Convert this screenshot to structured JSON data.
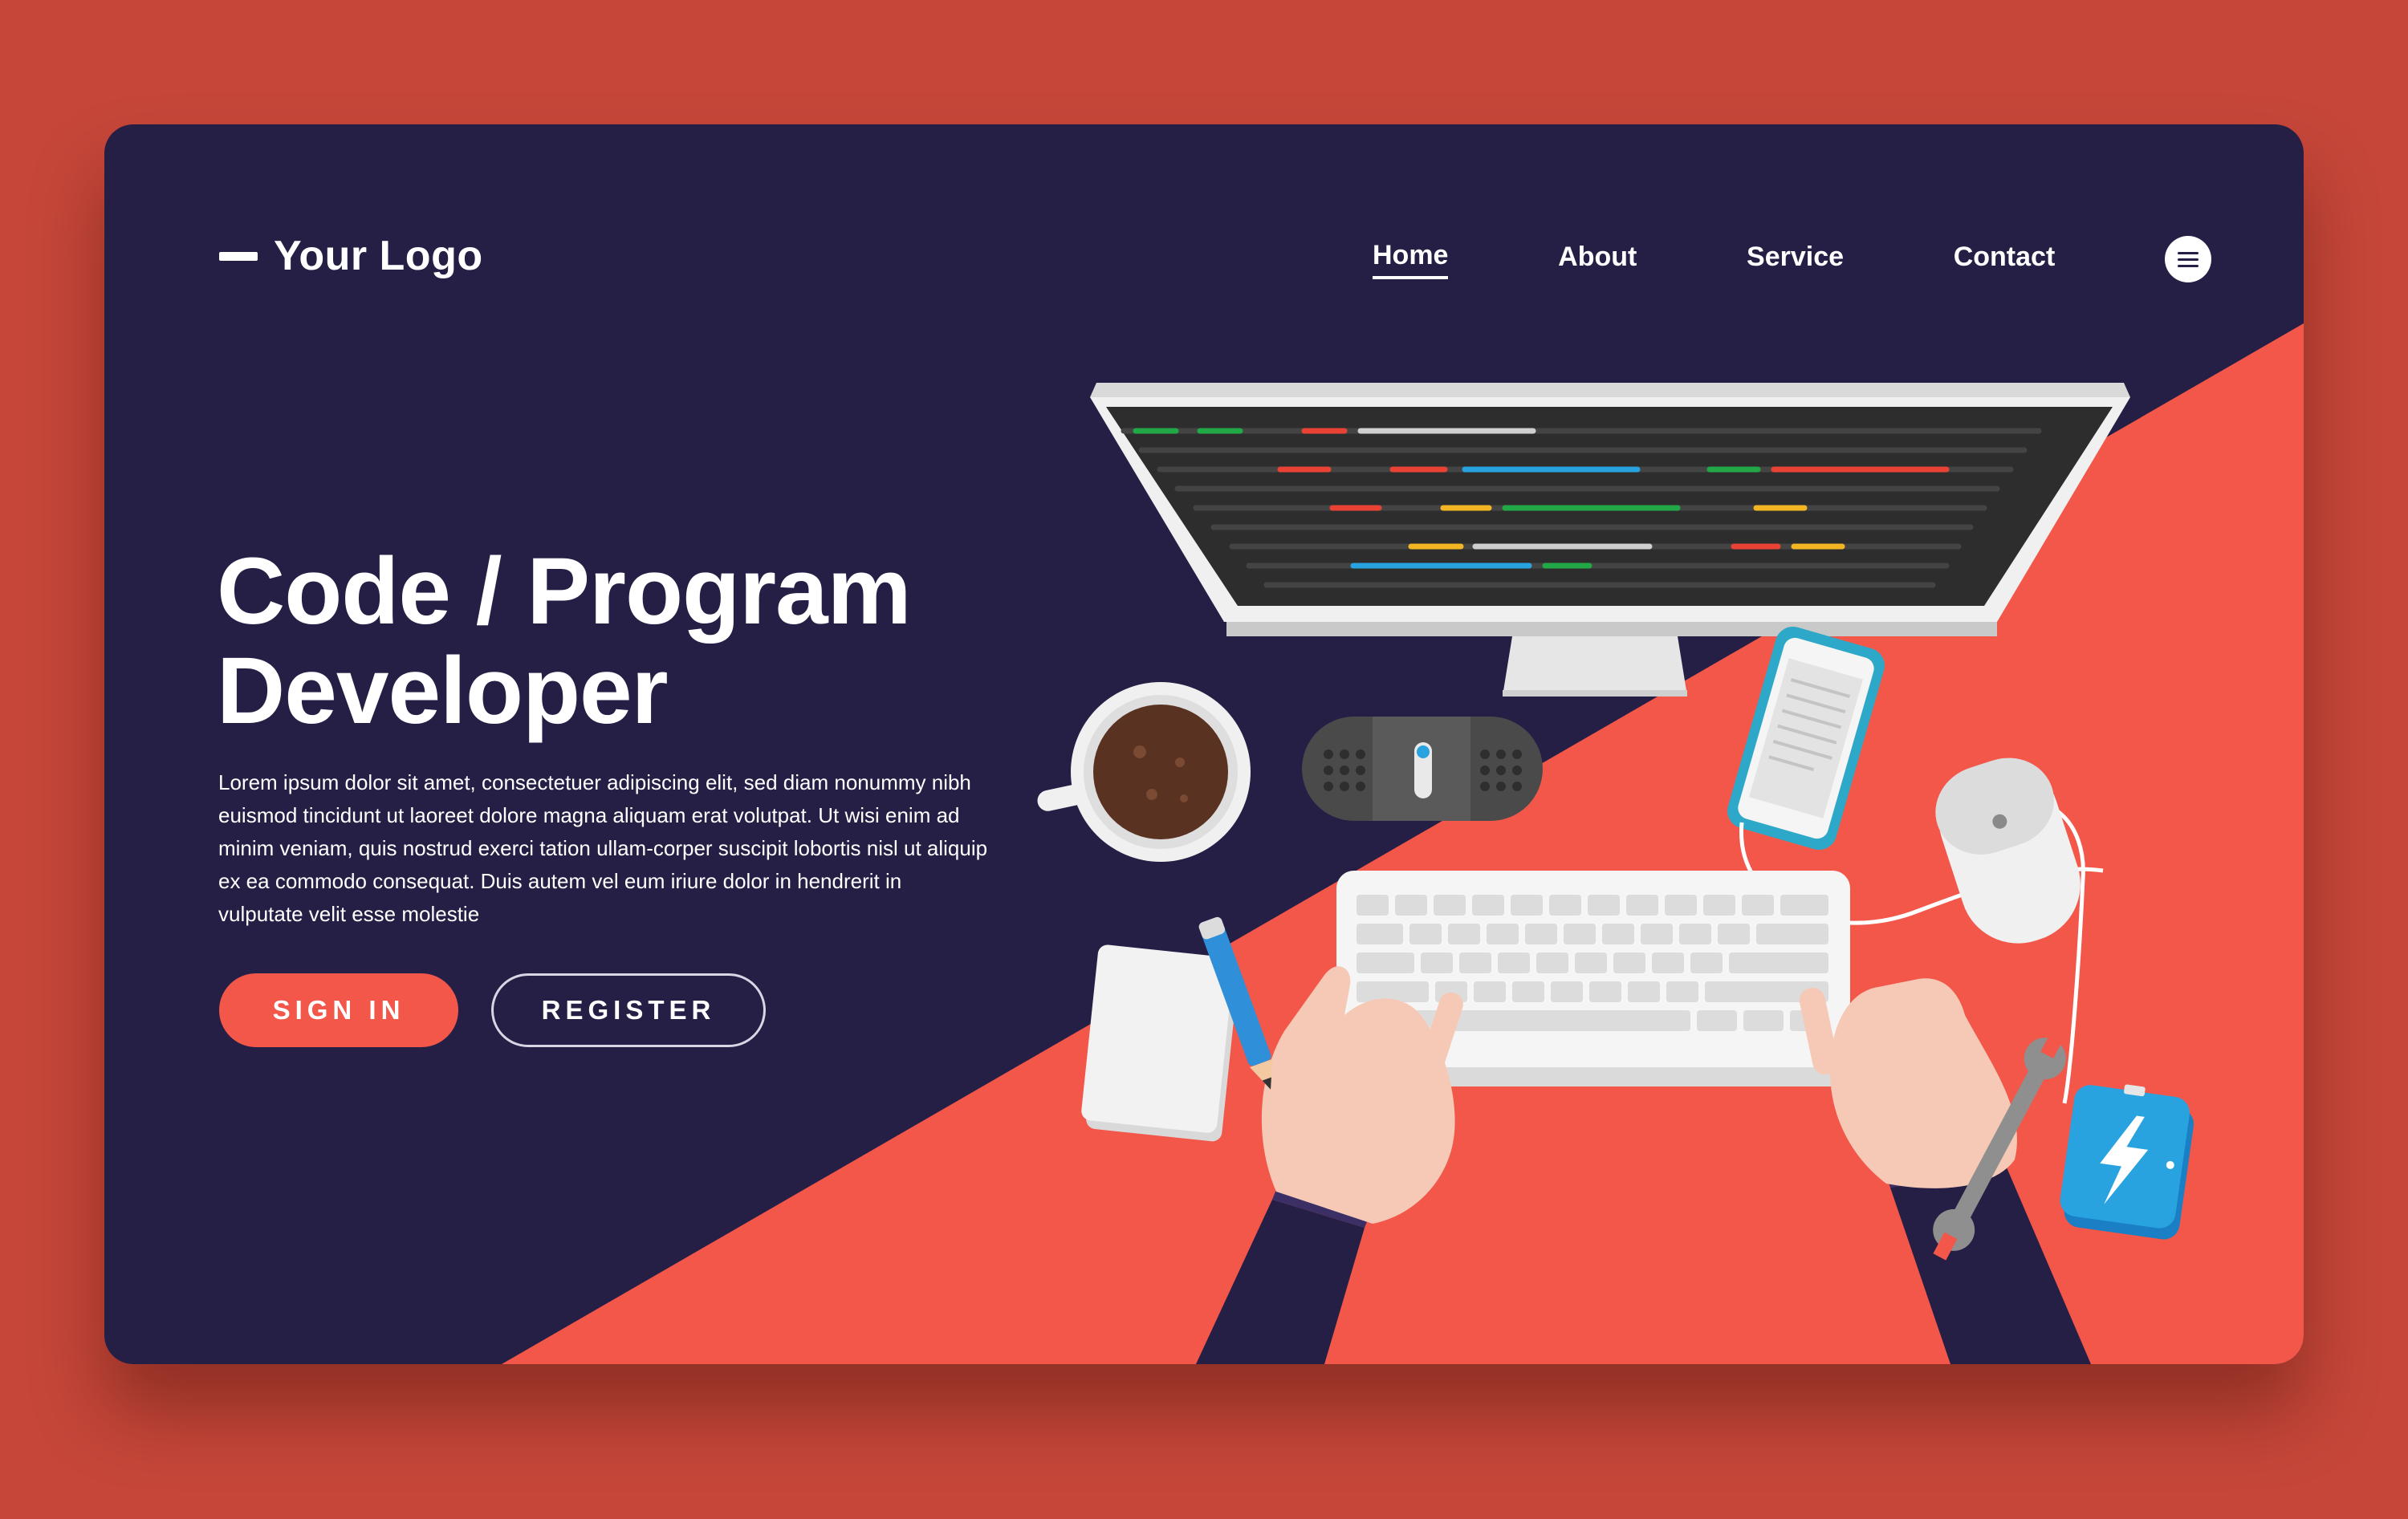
{
  "header": {
    "logo_text": "Your Logo",
    "nav": [
      {
        "label": "Home",
        "active": true
      },
      {
        "label": "About",
        "active": false
      },
      {
        "label": "Service",
        "active": false
      },
      {
        "label": "Contact",
        "active": false
      }
    ],
    "menu_icon": "hamburger-menu-icon"
  },
  "hero": {
    "title_line1": "Code / Program",
    "title_line2": "Developer",
    "body": "Lorem ipsum dolor sit amet, consectetuer adipiscing elit, sed diam nonummy nibh euismod tincidunt ut laoreet dolore magna aliquam erat volutpat. Ut wisi enim ad minim veniam, quis nostrud exerci tation ullam-corper suscipit lobortis nisl ut aliquip ex ea commodo consequat. Duis autem vel eum iriure dolor in hendrerit in vulputate velit esse molestie",
    "signin_label": "SIGN IN",
    "register_label": "REGISTER"
  },
  "colors": {
    "page_background": "#c6473a",
    "card_dark": "#251e45",
    "accent_red": "#f2574a",
    "text_white": "#ffffff"
  },
  "illustration": {
    "icons": [
      "monitor-icon",
      "coffee-cup-icon",
      "speaker-icon",
      "smartphone-icon",
      "mouse-icon",
      "keyboard-icon",
      "hands-icon",
      "notepad-icon",
      "pencil-icon",
      "wrench-icon",
      "power-bank-icon"
    ]
  }
}
